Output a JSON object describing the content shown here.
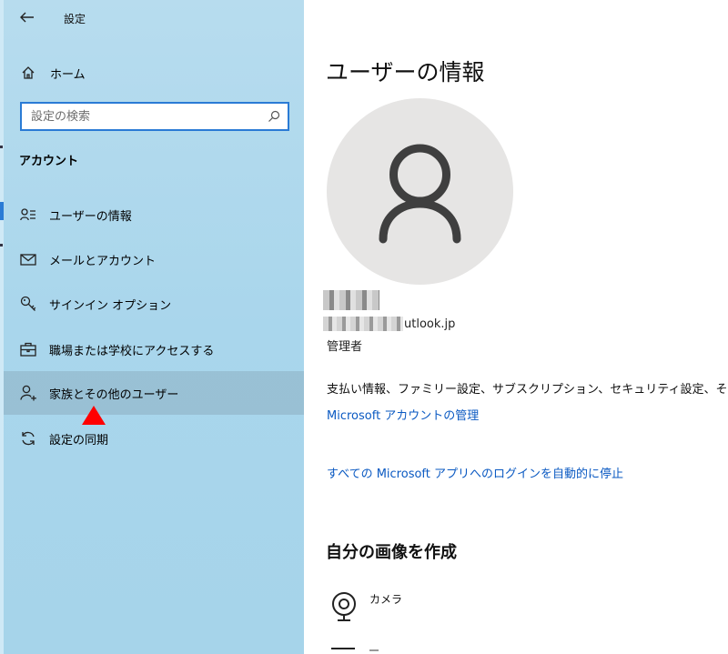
{
  "header": {
    "title": "設定"
  },
  "sidebar": {
    "home_label": "ホーム",
    "search_placeholder": "設定の検索",
    "section_title": "アカウント",
    "items": [
      {
        "label": "ユーザーの情報",
        "icon": "user-info-icon",
        "selected": false
      },
      {
        "label": "メールとアカウント",
        "icon": "mail-icon",
        "selected": false
      },
      {
        "label": "サインイン オプション",
        "icon": "key-icon",
        "selected": false
      },
      {
        "label": "職場または学校にアクセスする",
        "icon": "briefcase-icon",
        "selected": false
      },
      {
        "label": "家族とその他のユーザー",
        "icon": "person-add-icon",
        "selected": true
      },
      {
        "label": "設定の同期",
        "icon": "sync-icon",
        "selected": false
      }
    ]
  },
  "main": {
    "title": "ユーザーの情報",
    "email_visible": "utlook.jp",
    "role": "管理者",
    "billing_text": "支払い情報、ファミリー設定、サブスクリプション、セキュリティ設定、その他",
    "link_manage": "Microsoft アカウントの管理",
    "link_stop_signin": "すべての Microsoft アプリへのログインを自動的に停止",
    "create_picture_title": "自分の画像を作成",
    "camera_label": "カメラ"
  },
  "colors": {
    "sidebar_bg": "#a9d6ec",
    "accent": "#2a7bd5",
    "link": "#0a59c2",
    "selected_bg": "#8fb0bf",
    "pointer": "#ff0000",
    "avatar_bg": "#e6e5e4"
  }
}
